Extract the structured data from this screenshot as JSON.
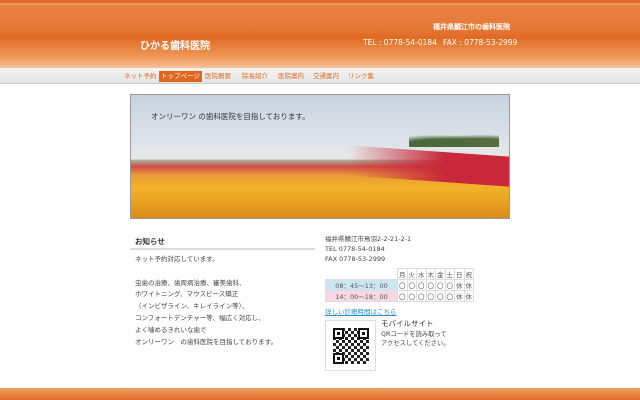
{
  "header": {
    "site_title": "ひかる歯科医院",
    "prefecture": "福井県鯖江市の歯科医院",
    "tel": "TEL : 0778-54-0184",
    "fax": "FAX : 0778-53-2999"
  },
  "nav": [
    {
      "label": "ネット予約"
    },
    {
      "label": "トップページ",
      "active": true
    },
    {
      "label": "医院概要"
    },
    {
      "label": "院長紹介"
    },
    {
      "label": "医院案内"
    },
    {
      "label": "交通案内"
    },
    {
      "label": "リンク集"
    }
  ],
  "hero": {
    "caption": "オンリーワン の歯科医院を目指しております。"
  },
  "news": {
    "title": "お知らせ",
    "body": "ネット予約対応しています。\n\n虫歯の治療、歯周病治療、審美歯科、\nホワイトニング、マウスピース矯正\n（インビザライン、キレイライン等）、\nコンフォートデンチャー等、幅広く対応し、\nよく噛めるきれいな歯で\nオンリーワン　の歯科医院を目指しております。"
  },
  "info": {
    "address": "福井県鯖江市鳥羽2-2-21-2-1",
    "tel": "TEL 0778-54-0184",
    "fax": "FAX 0778-53-2999"
  },
  "hours": {
    "days": [
      "月",
      "火",
      "水",
      "木",
      "金",
      "土",
      "日",
      "祝"
    ],
    "rows": [
      {
        "time": "08：45〜13：00",
        "marks": [
          "〇",
          "〇",
          "〇",
          "〇",
          "〇",
          "〇",
          "休",
          "休"
        ]
      },
      {
        "time": "14：00〜18：00",
        "marks": [
          "〇",
          "〇",
          "〇",
          "〇",
          "〇",
          "〇",
          "休",
          "休"
        ]
      }
    ]
  },
  "hours_link": "詳しい診療時間はこちら",
  "mobile": {
    "title": "モバイルサイト",
    "text": "QRコードを読み取って\nアクセスしてください。"
  }
}
